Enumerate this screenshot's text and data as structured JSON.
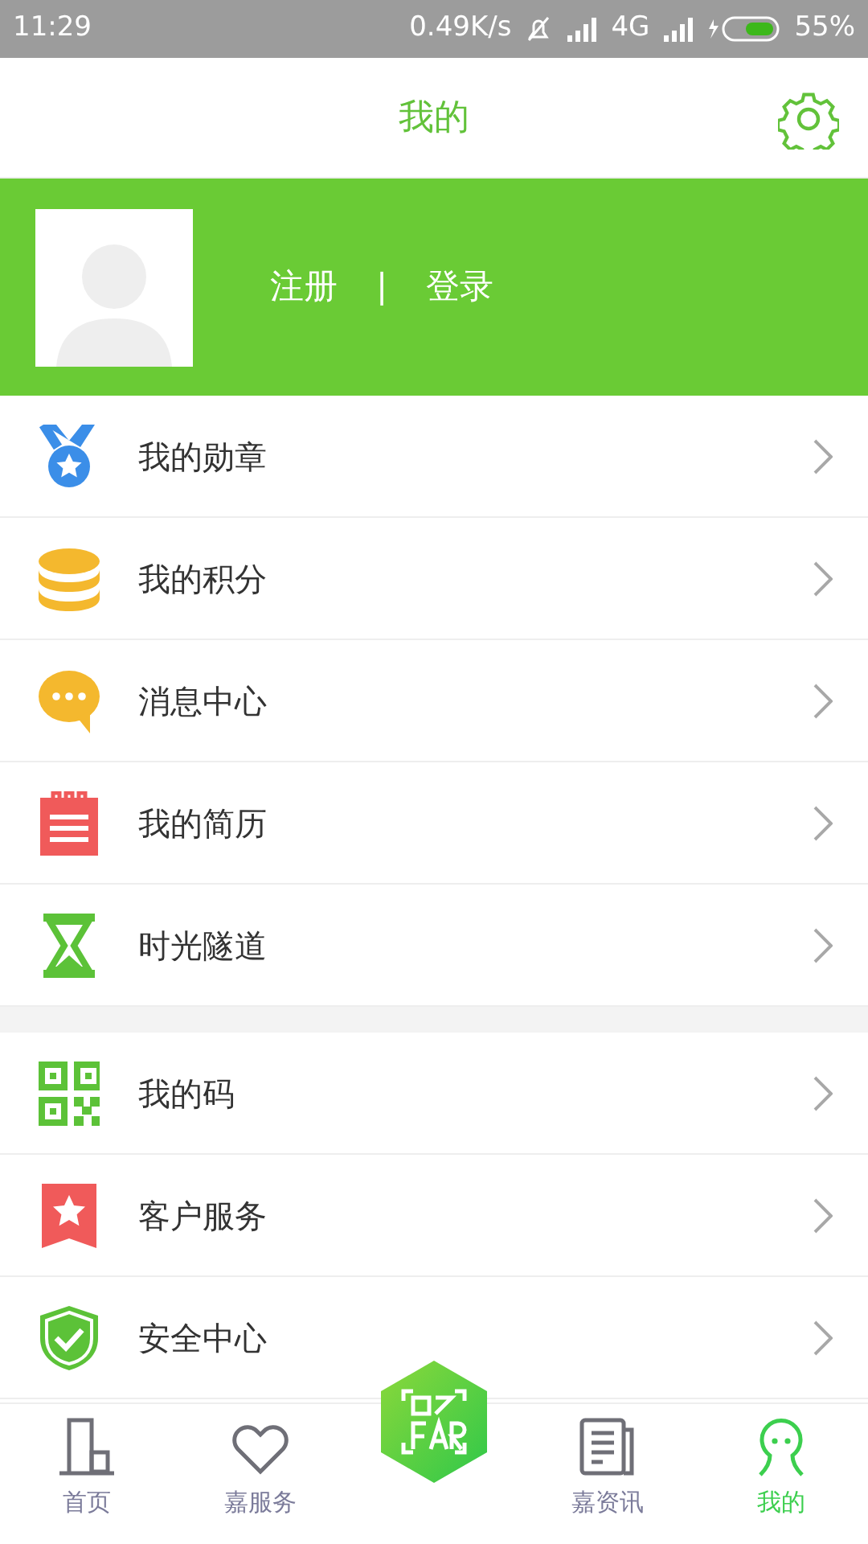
{
  "status_bar": {
    "time": "11:29",
    "speed": "0.49K/s",
    "network": "4G",
    "battery": "55%"
  },
  "header": {
    "title": "我的"
  },
  "profile": {
    "register": "注册",
    "separator": "|",
    "login": "登录"
  },
  "menu_groups": [
    [
      {
        "label": "我的勋章"
      },
      {
        "label": "我的积分"
      },
      {
        "label": "消息中心"
      },
      {
        "label": "我的简历"
      },
      {
        "label": "时光隧道"
      }
    ],
    [
      {
        "label": "我的码"
      },
      {
        "label": "客户服务"
      },
      {
        "label": "安全中心"
      }
    ]
  ],
  "bottom_nav": [
    {
      "label": "首页",
      "selected": false
    },
    {
      "label": "嘉服务",
      "selected": false
    },
    {
      "kind": "ar"
    },
    {
      "label": "嘉资讯",
      "selected": false
    },
    {
      "label": "我的",
      "selected": true
    }
  ]
}
